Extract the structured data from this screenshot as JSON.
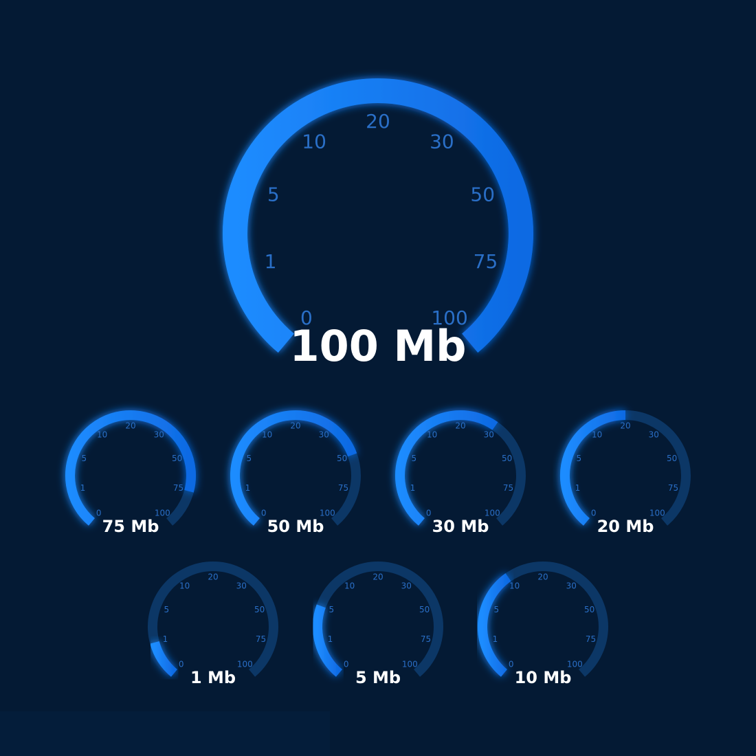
{
  "scale_ticks": [
    "0",
    "1",
    "5",
    "10",
    "20",
    "30",
    "50",
    "75",
    "100"
  ],
  "unit": "Mb",
  "colors": {
    "background": "#041a34",
    "arc_active": "#1a7cf0",
    "arc_track": "#0c3766",
    "tick_text": "#2a6fc7",
    "readout_text": "#ffffff"
  },
  "main_gauge": {
    "value": 100,
    "readout": "100 Mb"
  },
  "small_gauges": [
    {
      "value": 75,
      "readout": "75 Mb"
    },
    {
      "value": 50,
      "readout": "50 Mb"
    },
    {
      "value": 30,
      "readout": "30 Mb"
    },
    {
      "value": 20,
      "readout": "20 Mb"
    },
    {
      "value": 1,
      "readout": "1 Mb"
    },
    {
      "value": 5,
      "readout": "5 Mb"
    },
    {
      "value": 10,
      "readout": "10 Mb"
    }
  ]
}
